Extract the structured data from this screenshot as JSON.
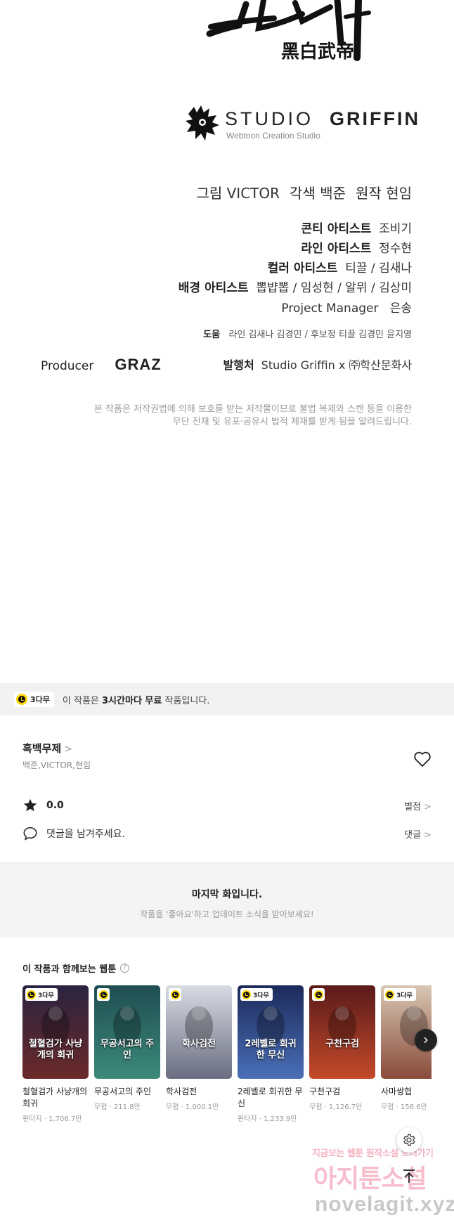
{
  "credits": {
    "title_art": {
      "main": "흑백무제",
      "sub": "黑白武帝"
    },
    "studio": {
      "name_light": "STUDIO",
      "name_bold": "GRIFFIN",
      "tagline": "Webtoon Creation Studio"
    },
    "main_line": {
      "art_label": "그림",
      "art_value": "VICTOR",
      "adapt_label": "각색",
      "adapt_value": "백준",
      "original_label": "원작",
      "original_value": "현임"
    },
    "staff": [
      {
        "role": "콘티 아티스트",
        "names": "조비기"
      },
      {
        "role": "라인 아티스트",
        "names": "정수현"
      },
      {
        "role": "컬러 아티스트",
        "names": "티끌 / 김새나"
      },
      {
        "role": "배경 아티스트",
        "names": "뽑뱝뽑 / 임성현 / 알뮈 / 김상미"
      },
      {
        "role": "Project Manager",
        "names": "은송"
      }
    ],
    "help": {
      "label": "도움",
      "text": "라인 김새나 김경민 / 후보정 티끌 김경민 윤지영"
    },
    "producer": {
      "label": "Producer",
      "value": "GRAZ"
    },
    "publisher": {
      "label": "발행처",
      "value": "Studio Griffin  x  ㈜학산문화사"
    },
    "copyright": [
      "본 작품은 저작권법에 의해 보호를 받는 저작물이므로 불법 복제와 스캔 등을 이용한",
      "무단 전재 및 유포·공유시 법적 제재를 받게 됨을 알려드립니다."
    ]
  },
  "free_banner": {
    "badge": "3다무",
    "text_before": "이 작품은 ",
    "text_bold": "3시간마다 무료",
    "text_after": " 작품입니다."
  },
  "work": {
    "title": "흑백무제",
    "authors": "백준,VICTOR,현임",
    "rating": "0.0",
    "rating_link": "별점",
    "comment_placeholder": "댓글을 남겨주세요.",
    "comment_link": "댓글"
  },
  "last_episode": {
    "title": "마지막 화입니다.",
    "subtitle": "작품을 '좋아요'하고 업데이트 소식을 받아보세요!"
  },
  "recommendations": {
    "title": "이 작품과 함께보는 웹툰",
    "items": [
      {
        "title": "철혈검가 사냥개의 회귀",
        "meta": "판타지 · 1,706.7만",
        "badge": "3다무",
        "cover_text": "철혈검가 사냥개의 회귀",
        "colors": [
          "#2a2340",
          "#6b2a2a"
        ]
      },
      {
        "title": "무공서고의 주인",
        "meta": "무협 · 211.8만",
        "badge": "",
        "cover_text": "무공서고의 주인",
        "colors": [
          "#1f4d52",
          "#3c8a7a"
        ]
      },
      {
        "title": "학사검전",
        "meta": "무협 · 1,000.1만",
        "badge": "",
        "cover_text": "학사검전",
        "colors": [
          "#d9dbe3",
          "#6a6d80"
        ]
      },
      {
        "title": "2레벨로 회귀한 무신",
        "meta": "판타지 · 1,233.9만",
        "badge": "3다무",
        "cover_text": "2레벨로 회귀한 무신",
        "colors": [
          "#1c2a5a",
          "#4a6fb8"
        ]
      },
      {
        "title": "구천구검",
        "meta": "무협 · 1,126.7만",
        "badge": "",
        "cover_text": "구천구검",
        "colors": [
          "#5a1a1a",
          "#c44a2a"
        ]
      },
      {
        "title": "사마쌍협",
        "meta": "무협 · 156.6만",
        "badge": "3다무",
        "cover_text": "",
        "colors": [
          "#d8c7b4",
          "#8a4a3a"
        ]
      }
    ]
  },
  "watermark": {
    "small": "지금보는 웹툰 원작소설 보러가기",
    "big": "아지툰소설",
    "url": "novelagit.xyz"
  },
  "icons": {
    "heart": "heart-outline-icon",
    "star": "star-icon",
    "comment": "speech-bubble-icon",
    "gear": "gear-icon",
    "to_top": "arrow-up-icon",
    "next": "chevron-right-icon"
  },
  "colors": {
    "free_accent": "#ffd400",
    "watermark_pink": "#f4a9bd"
  }
}
